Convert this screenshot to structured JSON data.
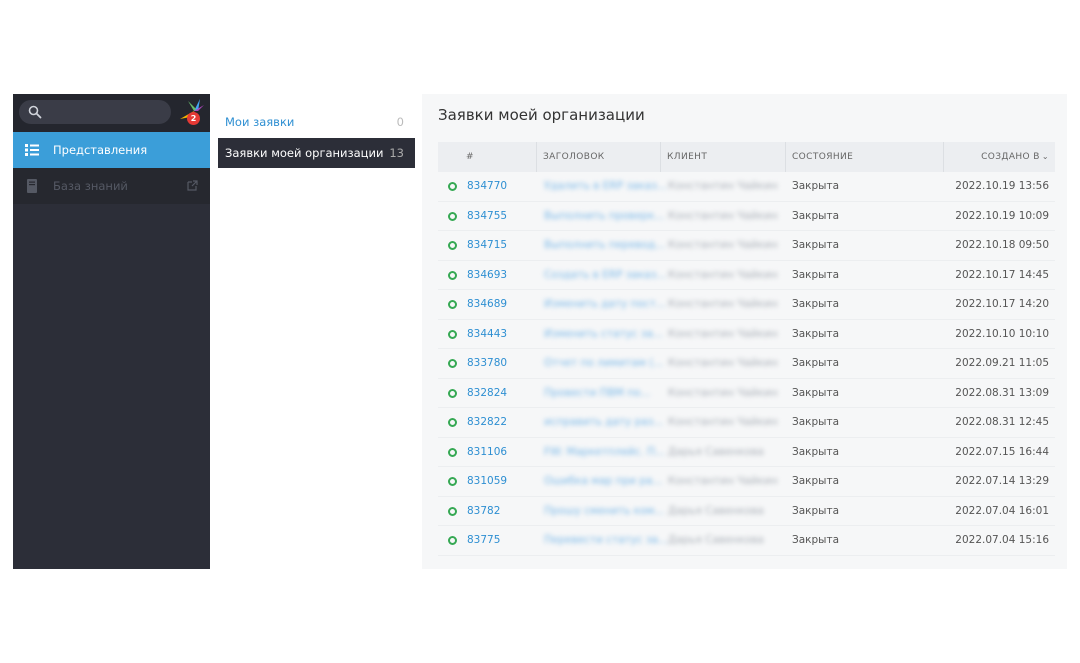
{
  "sidebar": {
    "search_placeholder": "",
    "badge_count": "2",
    "items": [
      {
        "label": "Представления",
        "active": true
      },
      {
        "label": "База знаний",
        "active": false
      }
    ]
  },
  "views": {
    "items": [
      {
        "label": "Мои заявки",
        "count": "0"
      },
      {
        "label": "Заявки моей организации",
        "count": "13"
      }
    ]
  },
  "main": {
    "title": "Заявки моей организации",
    "columns": {
      "num": "#",
      "title": "ЗАГОЛОВОК",
      "client": "КЛИЕНТ",
      "state": "СОСТОЯНИЕ",
      "created": "СОЗДАНО В"
    },
    "rows": [
      {
        "id": "834770",
        "title": "Удалить в ERP заказ...",
        "client": "Константин Чайкин",
        "state": "Закрыта",
        "created": "2022.10.19 13:56"
      },
      {
        "id": "834755",
        "title": "Выполнить проверк...",
        "client": "Константин Чайкин",
        "state": "Закрыта",
        "created": "2022.10.19 10:09"
      },
      {
        "id": "834715",
        "title": "Выполнить перевод...",
        "client": "Константин Чайкин",
        "state": "Закрыта",
        "created": "2022.10.18 09:50"
      },
      {
        "id": "834693",
        "title": "Создать в ERP заказ...",
        "client": "Константин Чайкин",
        "state": "Закрыта",
        "created": "2022.10.17 14:45"
      },
      {
        "id": "834689",
        "title": "Изменить дату пост...",
        "client": "Константин Чайкин",
        "state": "Закрыта",
        "created": "2022.10.17 14:20"
      },
      {
        "id": "834443",
        "title": "Изменить статус за...",
        "client": "Константин Чайкин",
        "state": "Закрыта",
        "created": "2022.10.10 10:10"
      },
      {
        "id": "833780",
        "title": "Отчет по лимитам (...",
        "client": "Константин Чайкин",
        "state": "Закрыта",
        "created": "2022.09.21 11:05"
      },
      {
        "id": "832824",
        "title": "Провести ПВМ по...",
        "client": "Константин Чайкин",
        "state": "Закрыта",
        "created": "2022.08.31 13:09"
      },
      {
        "id": "832822",
        "title": "исправить дату раз...",
        "client": "Константин Чайкин",
        "state": "Закрыта",
        "created": "2022.08.31 12:45"
      },
      {
        "id": "831106",
        "title": "FW: Маркетплейс. П...",
        "client": "Дарья Савенкова",
        "state": "Закрыта",
        "created": "2022.07.15 16:44"
      },
      {
        "id": "831059",
        "title": "Ошибка мар при ра...",
        "client": "Константин Чайкин",
        "state": "Закрыта",
        "created": "2022.07.14 13:29"
      },
      {
        "id": "83782",
        "title": "Прошу сменить ком...",
        "client": "Дарья Савенкова",
        "state": "Закрыта",
        "created": "2022.07.04 16:01"
      },
      {
        "id": "83775",
        "title": "Перевести статус за...",
        "client": "Дарья Савенкова",
        "state": "Закрыта",
        "created": "2022.07.04 15:16"
      }
    ]
  }
}
